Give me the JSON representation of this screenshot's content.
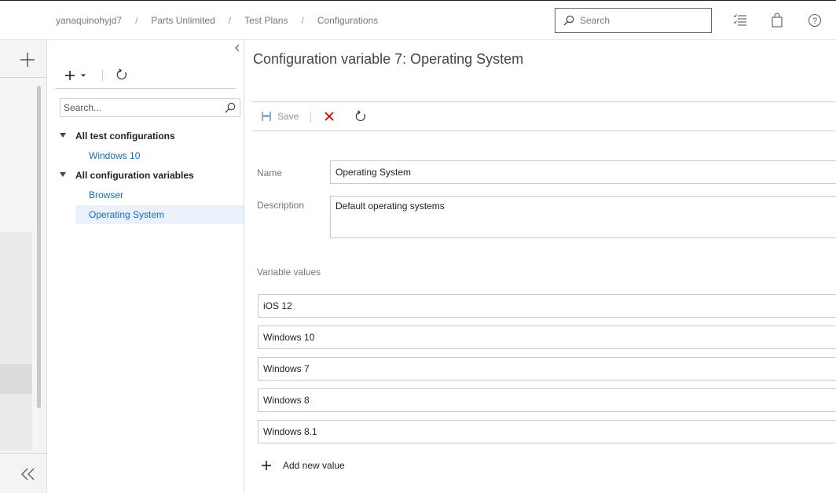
{
  "header": {
    "breadcrumb": [
      "yanaquinohyjd7",
      "Parts Unlimited",
      "Test Plans",
      "Configurations"
    ],
    "breadcrumb_separator": "/",
    "search_placeholder": "Search",
    "icons": [
      "list-icon",
      "shopping-bag-icon",
      "help-icon"
    ]
  },
  "rail": {
    "icons": [
      "plus-icon",
      "double-chevron-left-icon"
    ]
  },
  "tree": {
    "toolbar": {
      "icons": [
        "plus-icon",
        "caret-down-icon",
        "refresh-icon"
      ]
    },
    "search_placeholder": "Search...",
    "groups": [
      {
        "label": "All test configurations",
        "items": [
          "Windows 10"
        ]
      },
      {
        "label": "All configuration variables",
        "items": [
          "Browser",
          "Operating System"
        ]
      }
    ],
    "selected_item": "Operating System"
  },
  "main": {
    "title": "Configuration variable 7: Operating System",
    "commands": {
      "save_label": "Save",
      "icons": [
        "save-icon",
        "delete-icon",
        "refresh-icon"
      ]
    },
    "name_label": "Name",
    "name_value": "Operating System",
    "description_label": "Description",
    "description_value": "Default operating systems",
    "variable_values_label": "Variable values",
    "variable_values": [
      "iOS 12",
      "Windows 10",
      "Windows 7",
      "Windows 8",
      "Windows 8.1"
    ],
    "add_value_label": "Add new value"
  },
  "colors": {
    "link": "#106ebe",
    "selected_row": "#eaf1fa",
    "delete_red": "#d40000"
  }
}
